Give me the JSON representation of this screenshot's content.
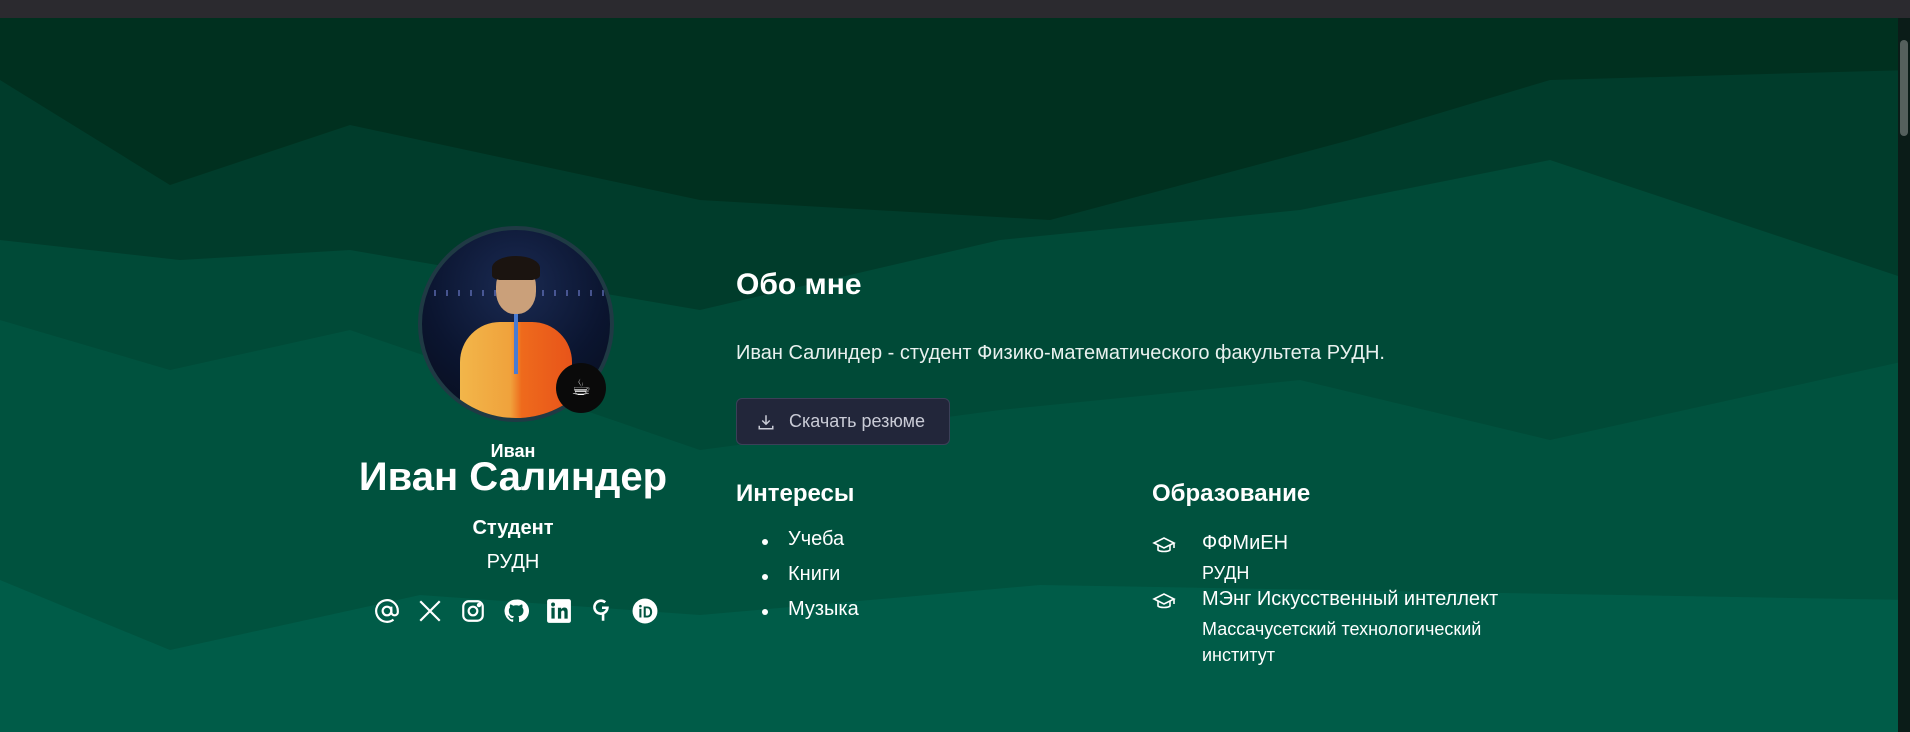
{
  "profile": {
    "nickname": "Иван",
    "name": "Иван Салиндер",
    "role": "Студент",
    "organization": "РУДН",
    "status_icon": "coffee-icon",
    "avatar": "profile-photo",
    "socials": [
      {
        "name": "email-icon"
      },
      {
        "name": "x-twitter-icon"
      },
      {
        "name": "instagram-icon"
      },
      {
        "name": "github-icon"
      },
      {
        "name": "linkedin-icon"
      },
      {
        "name": "google-scholar-icon"
      },
      {
        "name": "orcid-icon"
      }
    ]
  },
  "about": {
    "title": "Обо мне",
    "text": "Иван Салиндер - студент Физико-математического факультета РУДН.",
    "resume_button": "Скачать резюме"
  },
  "interests": {
    "title": "Интересы",
    "items": [
      "Учеба",
      "Книги",
      "Музыка"
    ]
  },
  "education": {
    "title": "Образование",
    "items": [
      {
        "degree": "ФФМиЕН",
        "institution": "РУДН"
      },
      {
        "degree": "МЭнг Искусственный интеллект",
        "institution": "Массачусетский технологический институт"
      }
    ]
  },
  "colors": {
    "background": "#00533f",
    "background_dark": "#00321f",
    "button_bg": "#22263a",
    "text": "#ffffff"
  }
}
